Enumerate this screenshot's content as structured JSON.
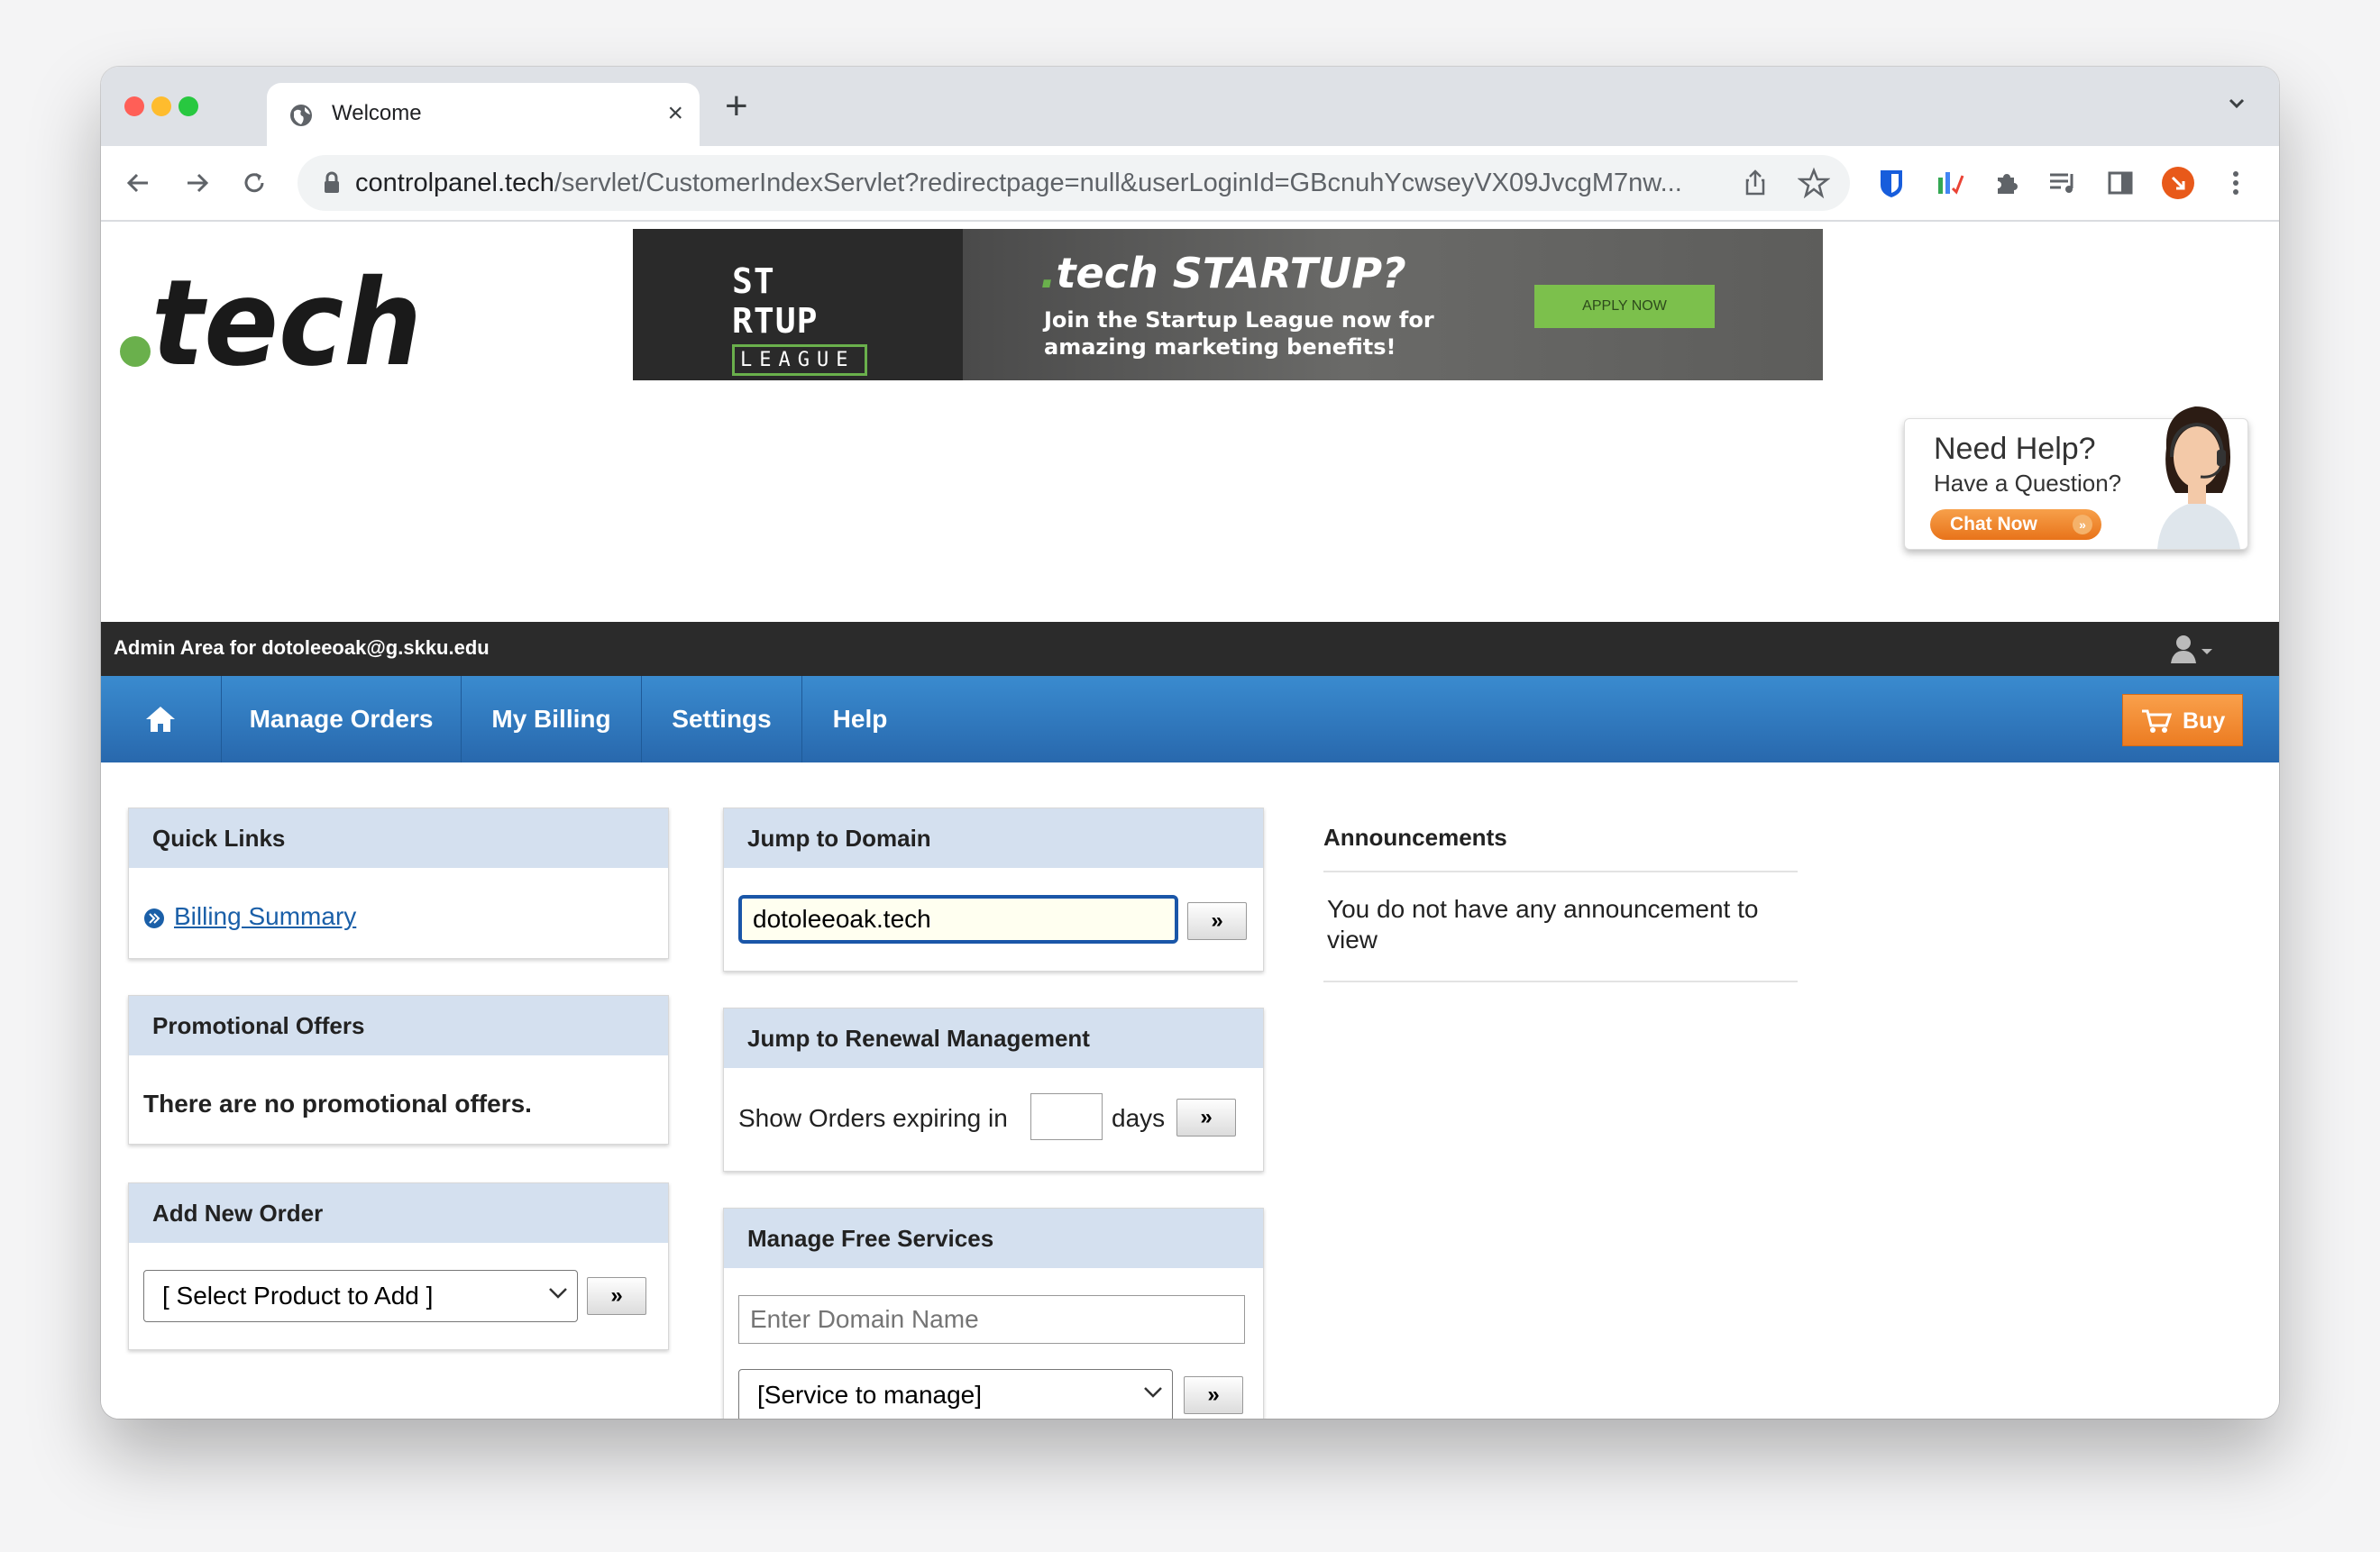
{
  "browser": {
    "tab_title": "Welcome",
    "url_domain": "controlpanel.tech",
    "url_path": "/servlet/CustomerIndexServlet?redirectpage=null&userLoginId=GBcnuhYcwseyVX09JvcgM7nw..."
  },
  "banner": {
    "logo_line1": "ST RTUP",
    "logo_line2": "LEAGUE",
    "headline_dot": ".",
    "headline": "tech STARTUP?",
    "subtext": "Join the Startup League now for amazing marketing benefits!",
    "cta": "APPLY NOW"
  },
  "help_widget": {
    "title": "Need Help?",
    "subtitle": "Have a Question?",
    "chat_button": "Chat Now"
  },
  "admin_bar": {
    "label": "Admin Area for dotoleeoak@g.skku.edu"
  },
  "nav": {
    "items": [
      "Manage Orders",
      "My Billing",
      "Settings",
      "Help"
    ],
    "buy_label": "Buy"
  },
  "quick_links": {
    "title": "Quick Links",
    "links": [
      "Billing Summary"
    ]
  },
  "promotional_offers": {
    "title": "Promotional Offers",
    "message": "There are no promotional offers."
  },
  "add_new_order": {
    "title": "Add New Order",
    "select_value": "[ Select Product to Add ]",
    "go_label": "»"
  },
  "jump_to_domain": {
    "title": "Jump to Domain",
    "input_value": "dotoleeoak.tech",
    "go_label": "»"
  },
  "jump_to_renewal": {
    "title": "Jump to Renewal Management",
    "prefix": "Show Orders expiring in",
    "days_value": "",
    "suffix": "days",
    "go_label": "»"
  },
  "manage_free_services": {
    "title": "Manage Free Services",
    "domain_placeholder": "Enter Domain Name",
    "select_value": "[Service to manage]",
    "go_label": "»"
  },
  "announcements": {
    "title": "Announcements",
    "message": "You do not have any announcement to view"
  },
  "colors": {
    "nav_blue": "#2f79bf",
    "panel_header": "#d4e0ef",
    "buy_orange": "#f2892f",
    "admin_bar": "#2b2b2b",
    "link": "#1a5fa8"
  }
}
